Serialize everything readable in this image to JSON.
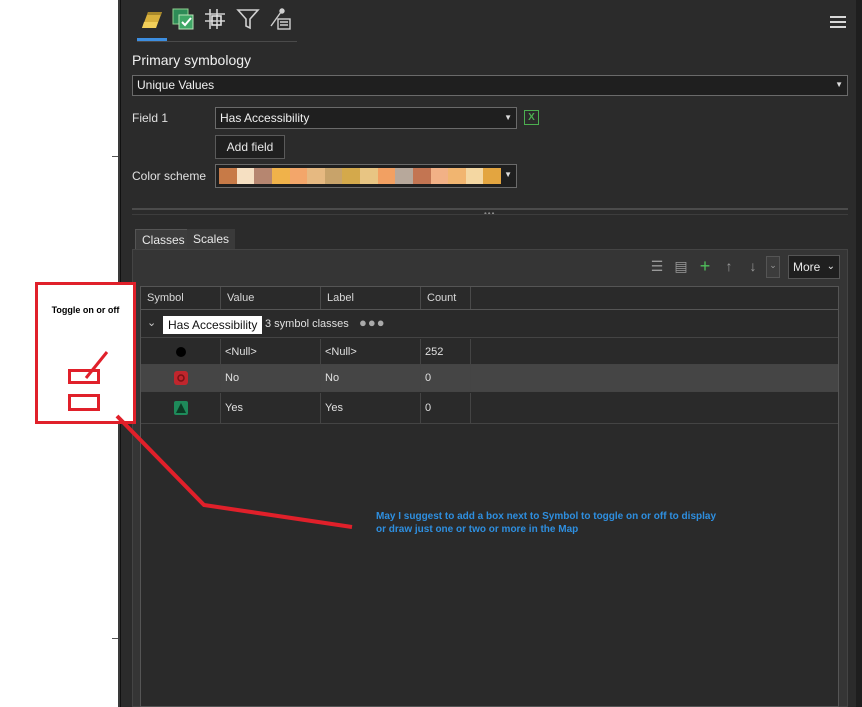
{
  "toolbar": {
    "icons": [
      "primary-symbology-icon",
      "vary-symbology-icon",
      "symbol-layer-drawing-icon",
      "filter-icon",
      "display-filter-icon"
    ],
    "menu_icon": "hamburger-menu-icon"
  },
  "symbology": {
    "section_title": "Primary symbology",
    "method": "Unique Values",
    "field1_label": "Field 1",
    "field1_value": "Has Accessibility",
    "add_field_label": "Add field",
    "color_scheme_label": "Color scheme",
    "color_scheme": [
      "#c77a47",
      "#f6e0c2",
      "#b68670",
      "#f0b24a",
      "#f3a66a",
      "#e6b981",
      "#c8a36a",
      "#d4a94b",
      "#e8c583",
      "#f2a062",
      "#b7a89b",
      "#c37552",
      "#f2b186",
      "#f1b570",
      "#f4d7a2",
      "#e3a540"
    ]
  },
  "tabs": [
    {
      "label": "Classes",
      "active": true
    },
    {
      "label": "Scales",
      "active": false
    }
  ],
  "classes_toolbar": {
    "more_label": "More"
  },
  "table": {
    "headers": [
      "Symbol",
      "Value",
      "Label",
      "Count"
    ],
    "group": {
      "name": "Has Accessibility",
      "summary": "3 symbol classes"
    },
    "rows": [
      {
        "value": "<Null>",
        "label": "<Null>",
        "count": "252"
      },
      {
        "value": "No",
        "label": "No",
        "count": "0"
      },
      {
        "value": "Yes",
        "label": "Yes",
        "count": "0"
      }
    ]
  },
  "annotation": {
    "box_title": "Toggle on or off",
    "suggestion": "May I suggest to add a box next to Symbol to toggle on or off to display or draw just one or two or more in the Map",
    "color": "#e0202a",
    "text_color": "#2e8fe0"
  }
}
